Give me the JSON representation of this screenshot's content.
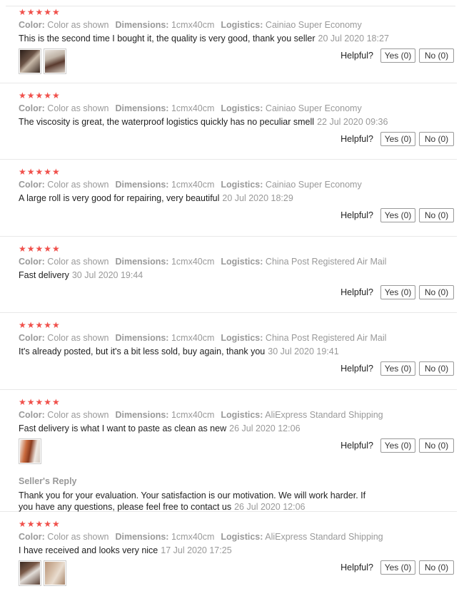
{
  "stars": "★★★★★",
  "labels": {
    "color": "Color:",
    "dimensions": "Dimensions:",
    "logistics": "Logistics:",
    "helpful": "Helpful?",
    "seller_reply": "Seller's Reply"
  },
  "reviews": [
    {
      "color": "Color as shown",
      "dimensions": "1cmx40cm",
      "logistics": "Cainiao Super Economy",
      "text": "This is the second time I bought it, the quality is very good, thank you seller",
      "date": "20 Jul 2020 18:27",
      "yes": "Yes (0)",
      "no": "No (0)"
    },
    {
      "color": "Color as shown",
      "dimensions": "1cmx40cm",
      "logistics": "Cainiao Super Economy",
      "text": "The viscosity is great, the waterproof logistics quickly has no peculiar smell",
      "date": "22 Jul 2020 09:36",
      "yes": "Yes (0)",
      "no": "No (0)"
    },
    {
      "color": "Color as shown",
      "dimensions": "1cmx40cm",
      "logistics": "Cainiao Super Economy",
      "text": "A large roll is very good for repairing, very beautiful",
      "date": "20 Jul 2020 18:29",
      "yes": "Yes (0)",
      "no": "No (0)"
    },
    {
      "color": "Color as shown",
      "dimensions": "1cmx40cm",
      "logistics": "China Post Registered Air Mail",
      "text": "Fast delivery",
      "date": "30 Jul 2020 19:44",
      "yes": "Yes (0)",
      "no": "No (0)"
    },
    {
      "color": "Color as shown",
      "dimensions": "1cmx40cm",
      "logistics": "China Post Registered Air Mail",
      "text": "It's already posted, but it's a bit less sold, buy again, thank you",
      "date": "30 Jul 2020 19:41",
      "yes": "Yes (0)",
      "no": "No (0)"
    },
    {
      "color": "Color as shown",
      "dimensions": "1cmx40cm",
      "logistics": "AliExpress Standard Shipping",
      "text": "Fast delivery is what I want to paste as clean as new",
      "date": "26 Jul 2020 12:06",
      "yes": "Yes (0)",
      "no": "No (0)",
      "reply": {
        "text": "Thank you for your evaluation. Your satisfaction is our motivation. We will work harder. If you have any questions, please feel free to contact us",
        "date": "26 Jul 2020 12:06"
      }
    },
    {
      "color": "Color as shown",
      "dimensions": "1cmx40cm",
      "logistics": "AliExpress Standard Shipping",
      "text": "I have received and looks very nice",
      "date": "17 Jul 2020 17:25",
      "yes": "Yes (0)",
      "no": "No (0)"
    }
  ],
  "colors": {
    "star": "#f0504b",
    "muted": "#999999",
    "text": "#222222",
    "divider": "#e8e8e8"
  }
}
